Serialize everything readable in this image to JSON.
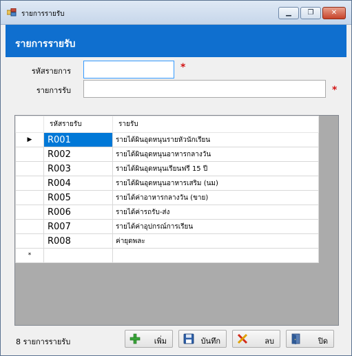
{
  "window": {
    "title": "รายการรายรับ",
    "controls": {
      "minimize": "▁",
      "maximize": "❐",
      "close": "✕"
    }
  },
  "header": {
    "title": "รายการรายรับ"
  },
  "form": {
    "code_label": "รหัสรายการ",
    "code_value": "",
    "name_label": "รายการรับ",
    "name_value": "",
    "required_mark": "*"
  },
  "grid": {
    "columns": [
      "รหัสรายรับ",
      "รายรับ"
    ],
    "current_row_marker": "▶",
    "new_row_marker": "*",
    "rows": [
      {
        "code": "R001",
        "name": "รายได้ผินอุดหนุนรายหัวนักเรียน"
      },
      {
        "code": "R002",
        "name": "รายได้ผินอุดหนุนอาหารกลางวัน"
      },
      {
        "code": "R003",
        "name": "รายได้ผินอุดหนุนเรียนฟรี 15 ปี"
      },
      {
        "code": "R004",
        "name": "รายได้ผินอุดหนุนอาหารเสริม (นม)"
      },
      {
        "code": "R005",
        "name": "รายได้ค่าอาหารกลางวัน (ขาย)"
      },
      {
        "code": "R006",
        "name": "รายได้ค่ารถรับ-ส่ง"
      },
      {
        "code": "R007",
        "name": "รายได้ค่าอุปกรณ์การเรียน"
      },
      {
        "code": "R008",
        "name": "ค่ายุดพละ"
      }
    ]
  },
  "status": {
    "count_text": "8 รายการรายรับ"
  },
  "buttons": {
    "add": "เพิ่ม",
    "save": "บันทึก",
    "delete": "ลบ",
    "close": "ปิด"
  },
  "colors": {
    "header_bg": "#0f6fcf",
    "required": "#d21414",
    "input_focus": "#3399ff"
  },
  "icons": {
    "add": "plus-icon",
    "save": "floppy-disk-icon",
    "delete": "x-icon",
    "close": "exit-door-icon",
    "app": "app-window-icon"
  }
}
